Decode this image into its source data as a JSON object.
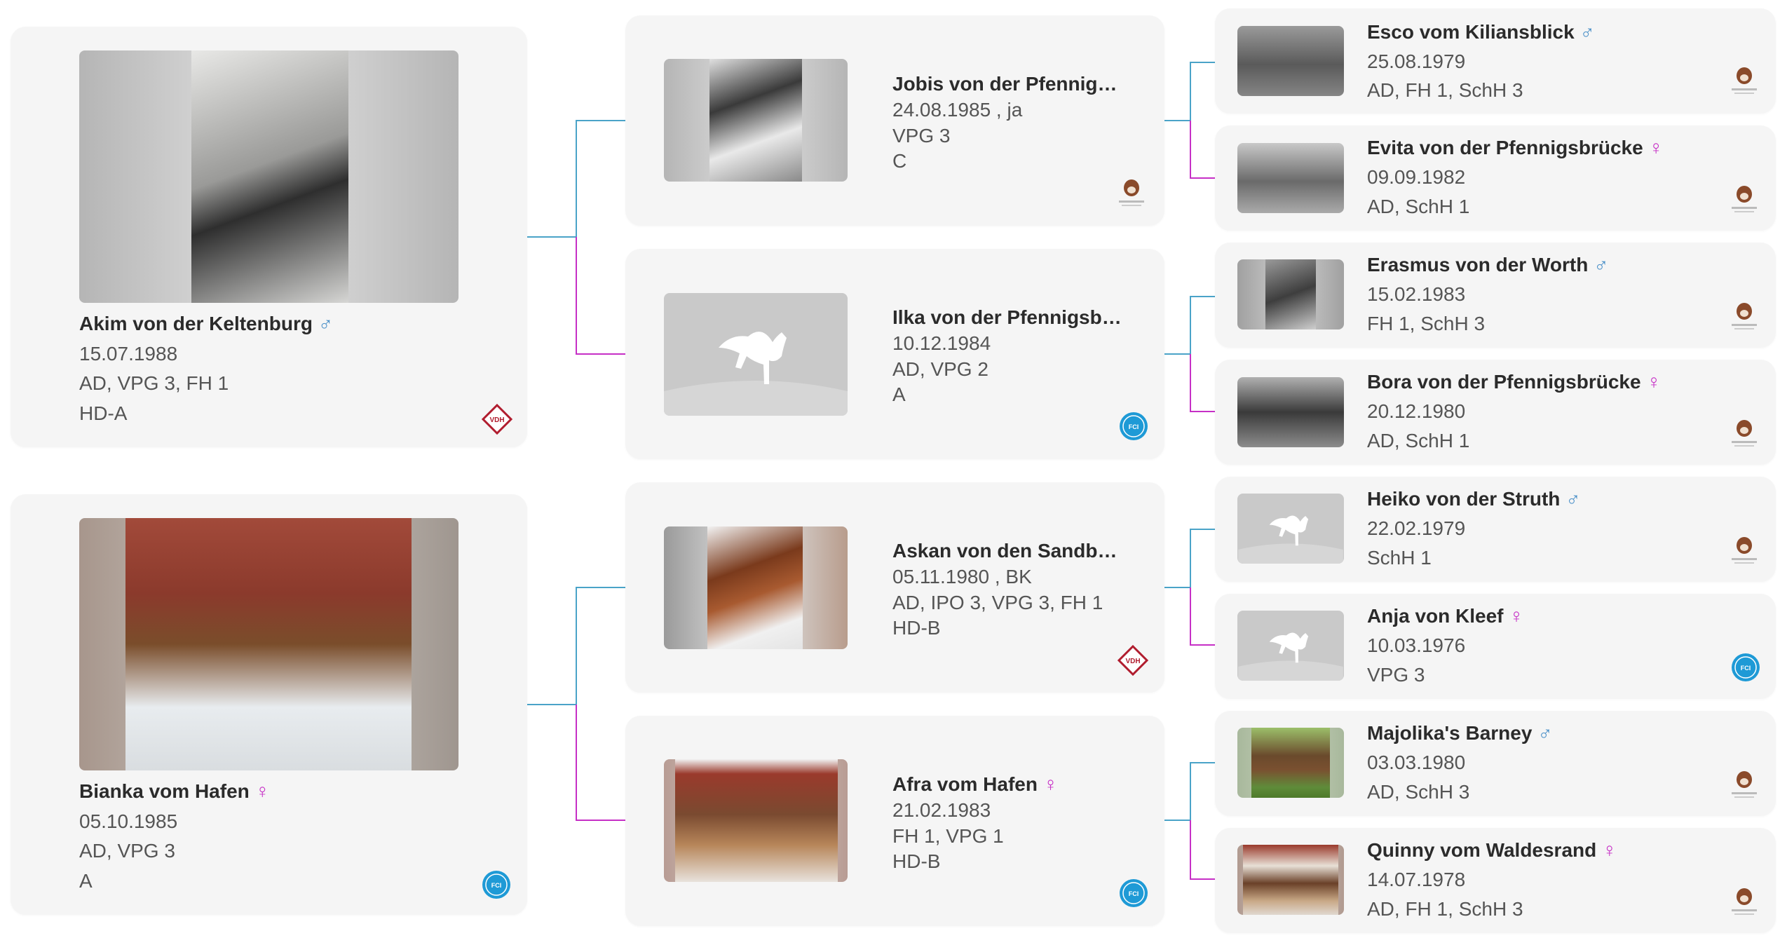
{
  "colors": {
    "male_line": "#4aa3c8",
    "female_line": "#c62fc6",
    "card_bg": "#f5f5f5"
  },
  "gen1": [
    {
      "name": "Akim von der Keltenburg",
      "sex": "♂",
      "date": "15.07.1988",
      "titles": "AD, VPG 3, FH 1",
      "hd": "HD-A",
      "badge": "VDH",
      "photo": "photo-bw-boxer-head"
    },
    {
      "name": "Bianka vom Hafen",
      "sex": "♀",
      "date": "05.10.1985",
      "titles": "AD, VPG 3",
      "hd": "A",
      "badge": "FCI",
      "photo": "photo-boxer-in-snow"
    }
  ],
  "gen2": [
    {
      "name": "Jobis von der Pfennigs...",
      "date": "24.08.1985 , ja",
      "titles": "VPG 3",
      "hd": "C",
      "badge": "Boxer-Klub",
      "photo": "photo-bw-boxer-head"
    },
    {
      "name": "Ilka von der Pfennigsbr...",
      "date": "10.12.1984",
      "titles": "AD, VPG 2",
      "hd": "A",
      "badge": "FCI",
      "photo": "placeholder-dog-icon"
    },
    {
      "name": "Askan von den Sandbe...",
      "date": "05.11.1980 , BK",
      "titles": "AD, IPO 3, VPG 3, FH 1",
      "hd": "HD-B",
      "badge": "VDH",
      "photo": "photo-boxer-head"
    },
    {
      "name": "Afra vom Hafen",
      "sex": "♀",
      "date": "21.02.1983",
      "titles": "FH 1, VPG 1",
      "hd": "HD-B",
      "badge": "FCI",
      "photo": "photo-boxer-lying"
    }
  ],
  "gen3": [
    {
      "name": "Esco vom Kiliansblick",
      "sex": "♂",
      "date": "25.08.1979",
      "titles": "AD, FH 1, SchH 3",
      "badge": "Boxer-Klub",
      "photo": "photo-bw-boxer-standing"
    },
    {
      "name": "Evita von der Pfennigsbrücke",
      "sex": "♀",
      "date": "09.09.1982",
      "titles": "AD, SchH 1",
      "badge": "Boxer-Klub",
      "photo": "photo-bw-boxer-standing"
    },
    {
      "name": "Erasmus von der Worth",
      "sex": "♂",
      "date": "15.02.1983",
      "titles": "FH 1, SchH 3",
      "badge": "Boxer-Klub",
      "photo": "photo-bw-boxer-standing"
    },
    {
      "name": "Bora von der Pfennigsbrücke",
      "sex": "♀",
      "date": "20.12.1980",
      "titles": "AD, SchH 1",
      "badge": "Boxer-Klub",
      "photo": "photo-bw-boxer-standing"
    },
    {
      "name": "Heiko von der Struth",
      "sex": "♂",
      "date": "22.02.1979",
      "titles": "SchH 1",
      "badge": "Boxer-Klub",
      "photo": "placeholder-dog-icon"
    },
    {
      "name": "Anja von Kleef",
      "sex": "♀",
      "date": "10.03.1976",
      "titles": "VPG 3",
      "badge": "FCI",
      "photo": "placeholder-dog-icon"
    },
    {
      "name": "Majolika's Barney",
      "sex": "♂",
      "date": "03.03.1980",
      "titles": "AD, SchH 3",
      "badge": "Boxer-Klub",
      "photo": "photo-boxer-in-grass"
    },
    {
      "name": "Quinny vom Waldesrand",
      "sex": "♀",
      "date": "14.07.1978",
      "titles": "AD, FH 1, SchH 3",
      "badge": "Boxer-Klub",
      "photo": "photo-boxer-lying"
    }
  ]
}
